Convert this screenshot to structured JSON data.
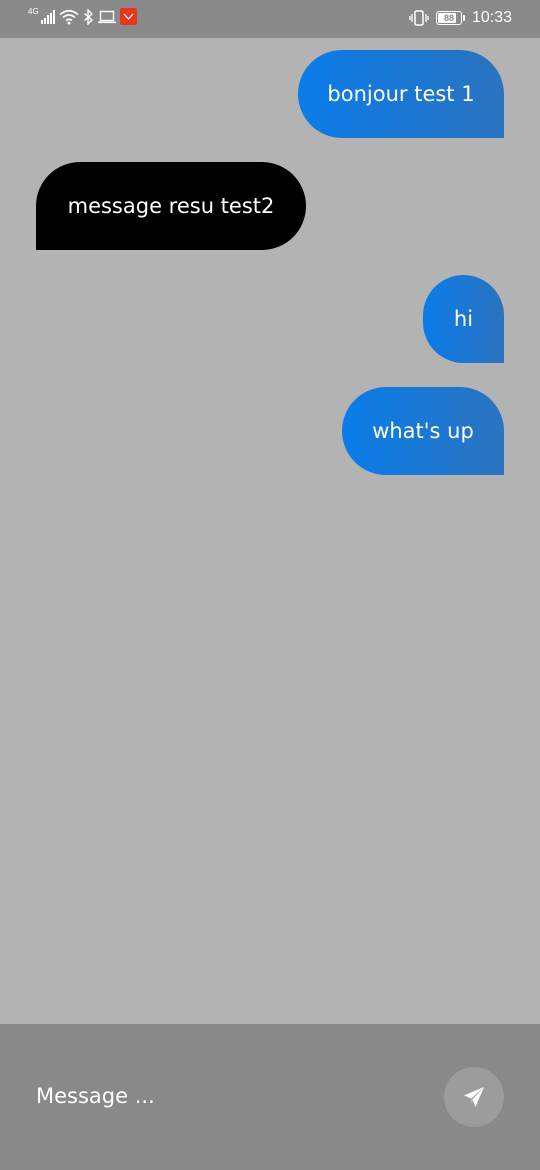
{
  "status_bar": {
    "network": "4G",
    "time": "10:33",
    "battery": "88",
    "battery_level": 0.88,
    "icons": [
      "signal-icon",
      "wifi-icon",
      "bluetooth-icon",
      "laptop-icon",
      "app-notification-icon",
      "vibrate-icon",
      "battery-icon"
    ]
  },
  "messages": [
    {
      "text": "bonjour test 1",
      "direction": "sent"
    },
    {
      "text": "message resu test2",
      "direction": "received"
    },
    {
      "text": "hi",
      "direction": "sent"
    },
    {
      "text": "what's up",
      "direction": "sent"
    }
  ],
  "composer": {
    "placeholder": "Message ...",
    "value": "",
    "send_icon": "send-icon"
  },
  "colors": {
    "background": "#b3b3b3",
    "sent_bubble": "#0a7ce8",
    "received_bubble": "#000000",
    "bars": "#8a8a8a",
    "notification": "#e8361c"
  }
}
